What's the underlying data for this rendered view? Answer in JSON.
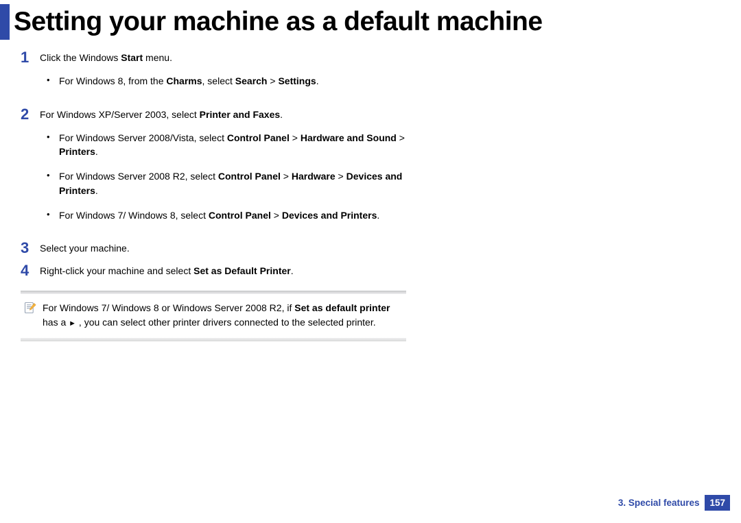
{
  "title": "Setting your machine as a default machine",
  "steps": {
    "s1": {
      "num": "1",
      "text_pre": "Click the Windows ",
      "text_bold": "Start",
      "text_post": " menu.",
      "bullets": {
        "b1_pre": "For Windows 8, from the ",
        "b1_bold1": "Charms",
        "b1_mid": ", select ",
        "b1_bold2": "Search",
        "b1_gt": " > ",
        "b1_bold3": "Settings",
        "b1_post": "."
      }
    },
    "s2": {
      "num": "2",
      "text_pre": "For Windows XP/Server 2003, select ",
      "text_bold": "Printer and Faxes",
      "text_post": ".",
      "bullets": {
        "b1_pre": "For Windows Server 2008/Vista, select ",
        "b1_bold1": "Control Panel",
        "b1_gt1": " > ",
        "b1_bold2": "Hardware and Sound",
        "b1_gt2": " > ",
        "b1_bold3": "Printers",
        "b1_post": ".",
        "b2_pre": "For Windows Server 2008 R2, select ",
        "b2_bold1": "Control Panel",
        "b2_gt1": " > ",
        "b2_bold2": "Hardware",
        "b2_gt2": " > ",
        "b2_bold3": "Devices and Printers",
        "b2_post": ".",
        "b3_pre": "For Windows 7/ Windows 8, select ",
        "b3_bold1": "Control Panel",
        "b3_gt1": " > ",
        "b3_bold2": "Devices and Printers",
        "b3_post": "."
      }
    },
    "s3": {
      "num": "3",
      "text": "Select your machine."
    },
    "s4": {
      "num": "4",
      "text_pre": "Right-click your machine and select ",
      "text_bold": "Set as Default Printer",
      "text_post": "."
    }
  },
  "note": {
    "pre": "For Windows 7/ Windows 8 or Windows Server 2008 R2, if ",
    "bold1": "Set as default printer",
    "mid1": " has a ",
    "tri": "►",
    "mid2": " , you can select other printer drivers connected to the selected printer."
  },
  "footer": {
    "label": "3.  Special features",
    "page": "157"
  }
}
